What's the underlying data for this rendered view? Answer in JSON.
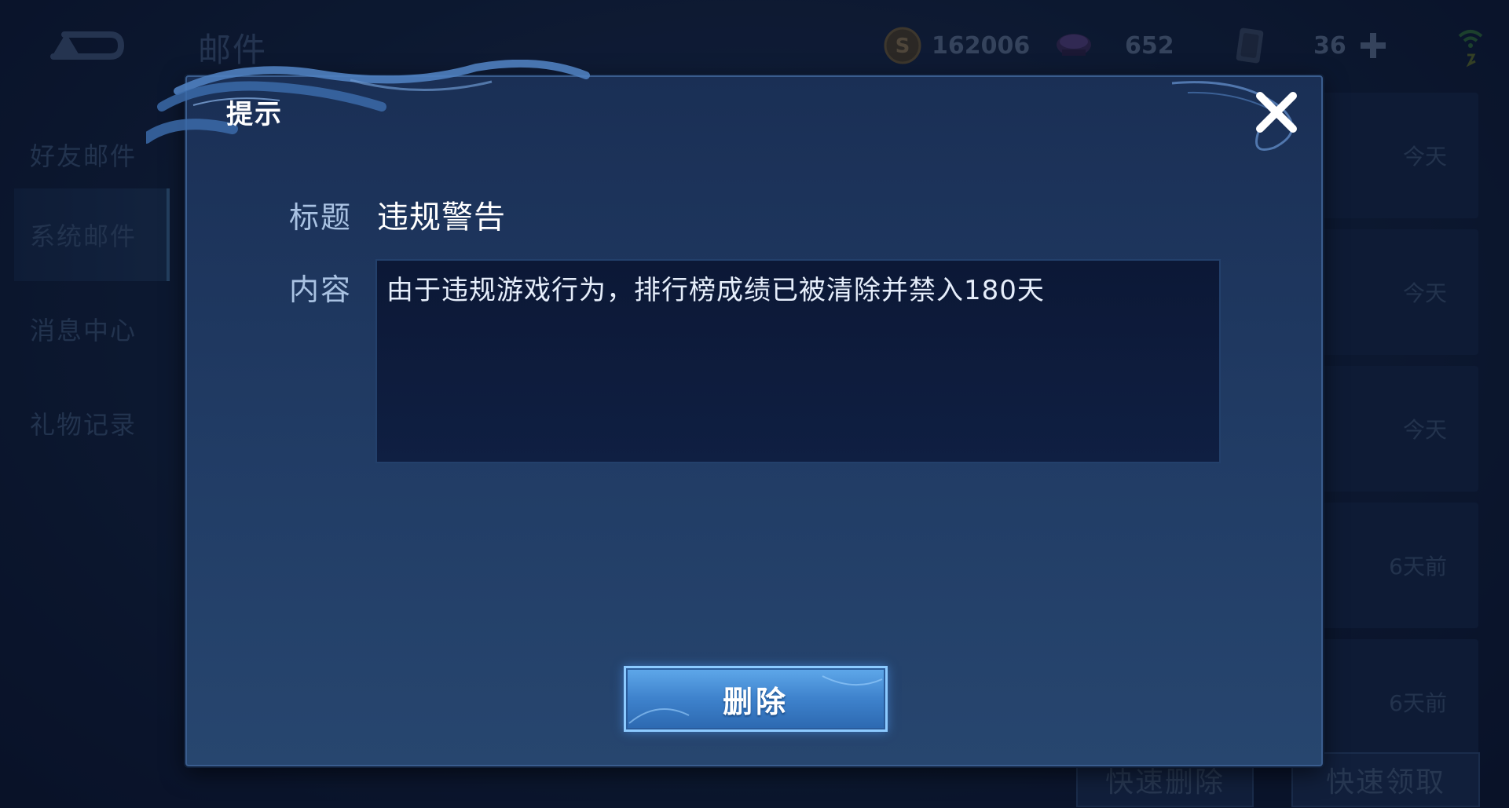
{
  "header": {
    "title": "邮件",
    "coins": "162006",
    "diamonds": "652",
    "tickets": "36"
  },
  "sidebar": {
    "items": [
      {
        "label": "好友邮件"
      },
      {
        "label": "系统邮件"
      },
      {
        "label": "消息中心"
      },
      {
        "label": "礼物记录"
      }
    ]
  },
  "mail_list": {
    "times": [
      "今天",
      "今天",
      "今天",
      "6天前",
      "6天前"
    ]
  },
  "bottom": {
    "quick_delete": "快速删除",
    "quick_claim": "快速领取"
  },
  "dialog": {
    "title": "提示",
    "subject_label": "标题",
    "subject_value": "违规警告",
    "content_label": "内容",
    "content_value": "由于违规游戏行为，排行榜成绩已被清除并禁入180天",
    "delete_label": "删除"
  },
  "colors": {
    "dialog_bg": "#213c65",
    "button_blue": "#3e82cc",
    "label_blue": "#a9c2e2"
  }
}
